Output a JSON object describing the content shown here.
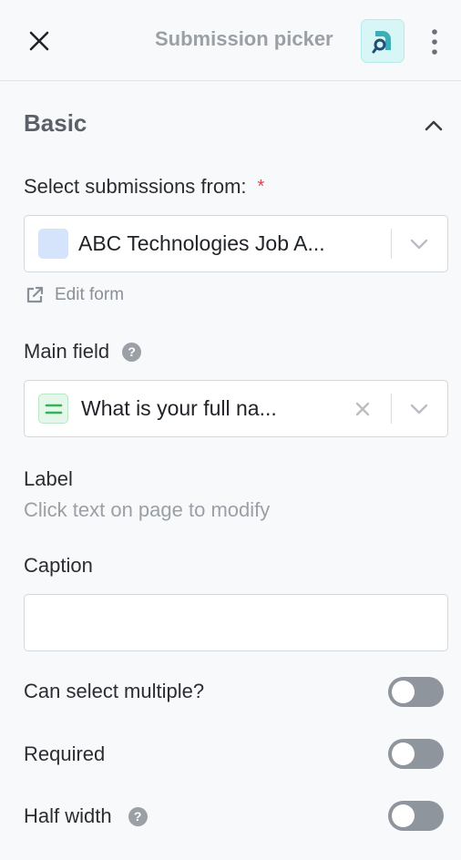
{
  "header": {
    "title": "Submission picker",
    "close_icon": "close-icon",
    "app_icon": "submission-app-icon",
    "menu_icon": "kebab-menu-icon",
    "accent_color": "#3ab0b6"
  },
  "section": {
    "title": "Basic",
    "toggle_icon": "chevron-up-icon"
  },
  "source": {
    "label": "Select submissions from:",
    "required_mark": "*",
    "value": "ABC Technologies Job A...",
    "edit_link": "Edit form"
  },
  "main_field": {
    "label": "Main field",
    "help": "?",
    "value": "What is your full na..."
  },
  "label_field": {
    "label": "Label",
    "hint": "Click text on page to modify"
  },
  "caption": {
    "label": "Caption",
    "value": "",
    "placeholder": ""
  },
  "toggles": {
    "multiple": {
      "label": "Can select multiple?",
      "on": false
    },
    "required": {
      "label": "Required",
      "on": false
    },
    "half_width": {
      "label": "Half width",
      "help": "?",
      "on": false
    }
  }
}
